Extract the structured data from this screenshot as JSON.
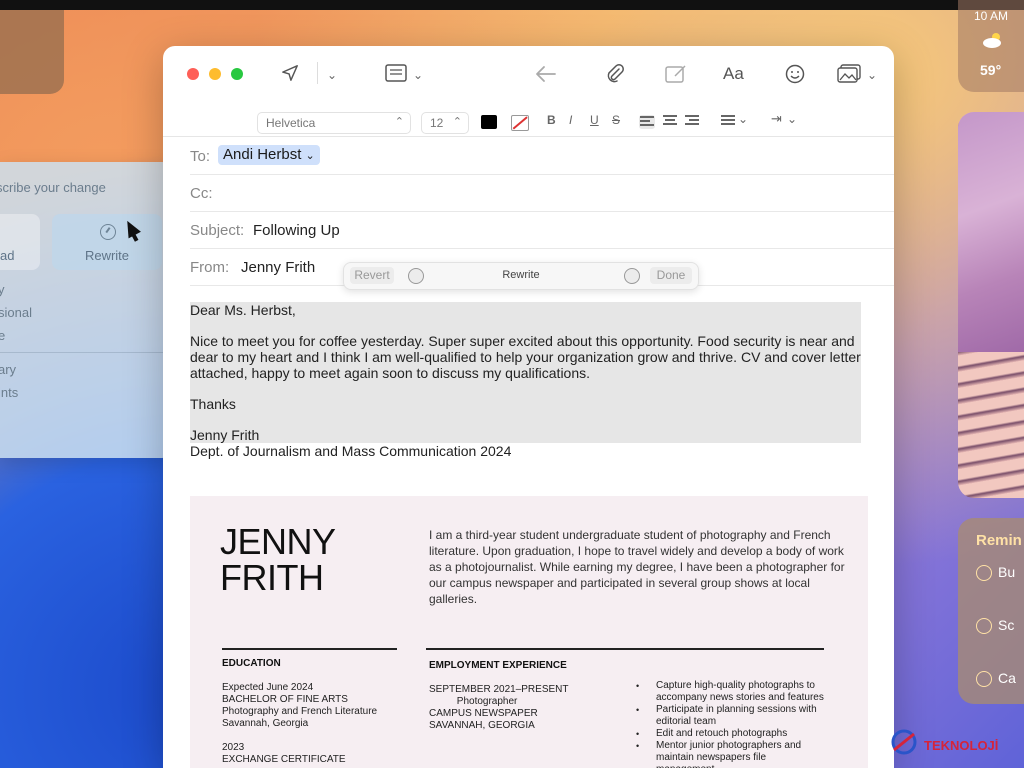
{
  "writing_tools": {
    "describe_placeholder": "scribe your change",
    "proofread_label": "ad",
    "rewrite_label": "Rewrite",
    "options": [
      "y",
      "sional",
      "e"
    ],
    "options2": [
      "ary",
      "ints"
    ]
  },
  "weather": {
    "time": "10 AM",
    "temp": "59°"
  },
  "reminders": {
    "title": "Remin",
    "items": [
      "Bu",
      "Sc",
      "Ca"
    ]
  },
  "toolbar": {
    "aa_label": "Aa"
  },
  "format": {
    "font": "Helvetica",
    "size": "12",
    "bold": "B",
    "italic": "I",
    "underline": "U",
    "strike": "S"
  },
  "header": {
    "to_label": "To:",
    "to_value": "Andi Herbst",
    "cc_label": "Cc:",
    "subject_label": "Subject:",
    "subject_value": "Following Up",
    "from_label": "From:",
    "from_value": "Jenny Frith"
  },
  "rewrite_bar": {
    "revert": "Revert",
    "label": "Rewrite",
    "done": "Done"
  },
  "body": {
    "greeting": "Dear Ms. Herbst,",
    "paragraph": "Nice to meet you for coffee yesterday. Super super excited about this opportunity. Food security is near and dear to my heart and I think I am well-qualified to help your organization grow and thrive. CV and cover letter attached, happy to meet again soon to discuss my qualifications.",
    "thanks": "Thanks",
    "signature_name": "Jenny Frith",
    "signature_dept": "Dept. of Journalism and Mass Communication 2024"
  },
  "resume": {
    "name_first": "JENNY",
    "name_last": "FRITH",
    "intro": "I am a third-year student undergraduate student of photography and French literature. Upon graduation, I hope to travel widely and develop a body of work as a photojournalist. While earning my degree, I have been a photographer for our campus newspaper and participated in several group shows at local galleries.",
    "education_heading": "EDUCATION",
    "education_text": "Expected June 2024\nBACHELOR OF FINE ARTS\nPhotography and French Literature\nSavannah, Georgia\n\n2023\nEXCHANGE CERTIFICATE",
    "employment_heading": "EMPLOYMENT EXPERIENCE",
    "employment_text": "SEPTEMBER 2021–PRESENT\n          Photographer\nCAMPUS NEWSPAPER\nSAVANNAH, GEORGIA",
    "bullets": [
      "Capture high-quality photographs to accompany news stories and features",
      "Participate in planning sessions with editorial team",
      "Edit and retouch photographs",
      "Mentor junior photographers and maintain newspapers file management"
    ]
  },
  "watermark": "TEKNOLOJİ"
}
